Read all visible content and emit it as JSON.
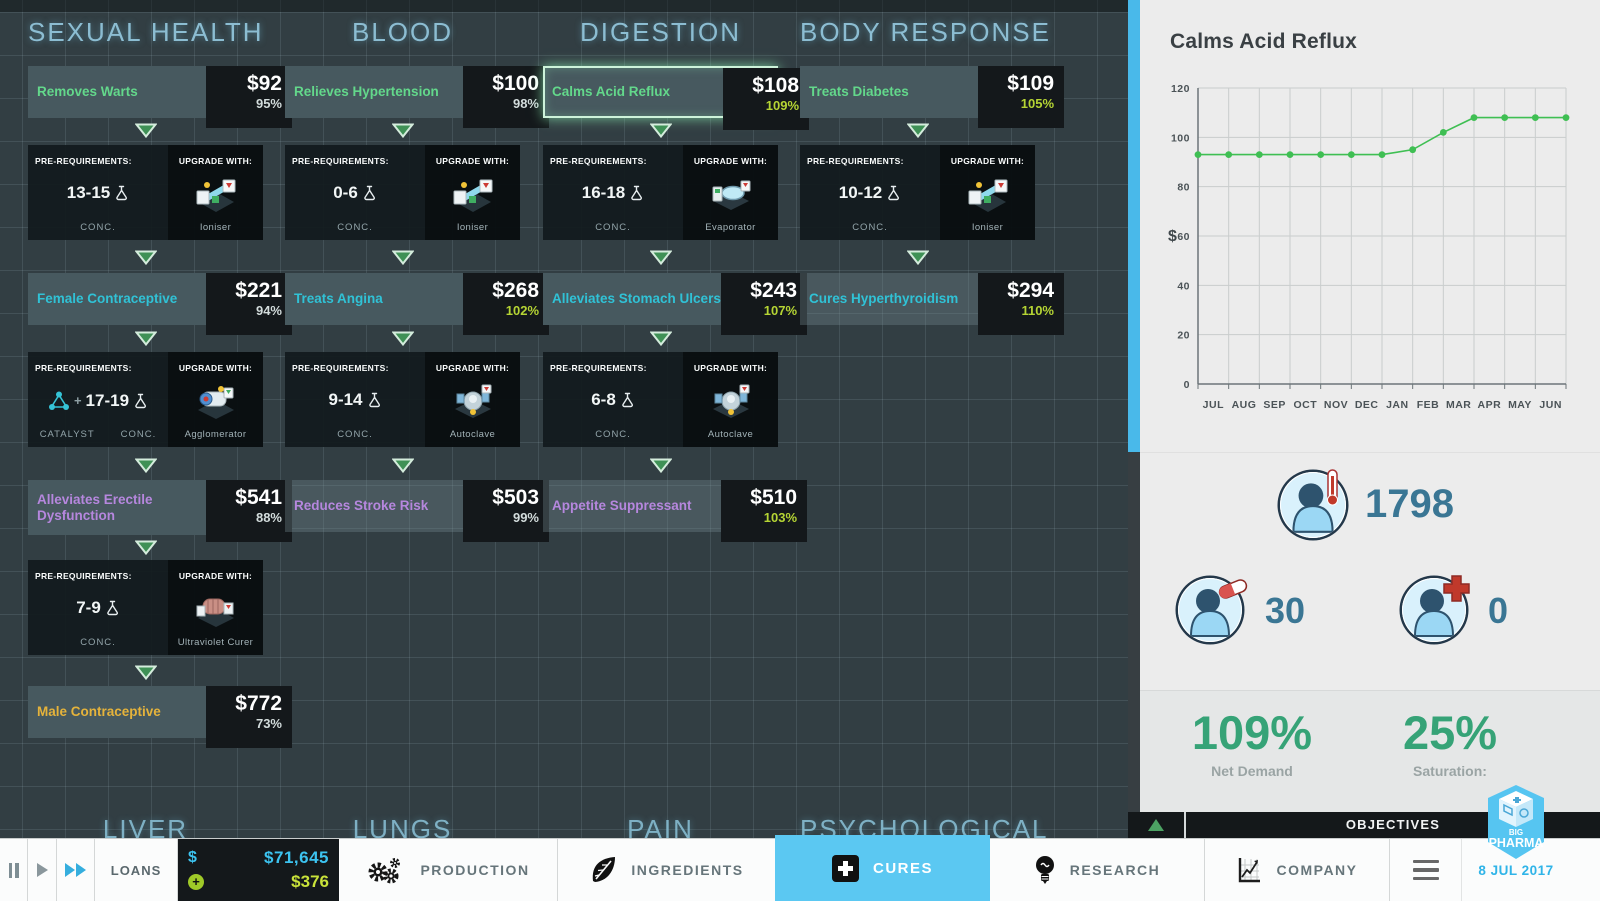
{
  "colors": {
    "accent_blue": "#5bc8f2",
    "tier_green": "#63d88b",
    "tier_cyan": "#30c2d6",
    "tier_purple": "#b687de",
    "tier_yellow": "#e5b33b",
    "pct_good_green": "#b5d434",
    "chart_line_green": "#3fbf53",
    "money_cyan": "#3cc3f0",
    "money_income_green": "#c9e23a",
    "stat_number_blue": "#3a7694",
    "panel_pct_green": "#36a377",
    "scrollbar_thumb": "#49b9ea"
  },
  "labels": {
    "prereq": "PRE-REQUIREMENTS:",
    "upgrade": "UPGRADE WITH:",
    "conc": "CONC.",
    "catalyst": "CATALYST"
  },
  "main": {
    "columns": [
      {
        "header": "SEXUAL HEALTH",
        "cures": [
          {
            "name": "Removes Warts",
            "price": "$92",
            "percent": "95%"
          },
          {
            "name": "Female Contraceptive",
            "price": "$221",
            "percent": "94%"
          },
          {
            "name": "Alleviates Erectile Dysfunction",
            "price": "$541",
            "percent": "88%"
          },
          {
            "name": "Male Contraceptive",
            "price": "$772",
            "percent": "73%"
          }
        ],
        "prereqs": [
          {
            "range": "13-15",
            "machine": "Ioniser"
          },
          {
            "range": "17-19",
            "machine": "Agglomerator",
            "catalyst": true
          },
          {
            "range": "7-9",
            "machine": "Ultraviolet Curer"
          }
        ]
      },
      {
        "header": "BLOOD",
        "cures": [
          {
            "name": "Relieves Hypertension",
            "price": "$100",
            "percent": "98%"
          },
          {
            "name": "Treats Angina",
            "price": "$268",
            "percent": "102%"
          },
          {
            "name": "Reduces Stroke Risk",
            "price": "$503",
            "percent": "99%"
          }
        ],
        "prereqs": [
          {
            "range": "0-6",
            "machine": "Ioniser"
          },
          {
            "range": "9-14",
            "machine": "Autoclave"
          }
        ]
      },
      {
        "header": "DIGESTION",
        "cures": [
          {
            "name": "Calms Acid Reflux",
            "price": "$108",
            "percent": "109%"
          },
          {
            "name": "Alleviates Stomach Ulcers",
            "price": "$243",
            "percent": "107%"
          },
          {
            "name": "Appetite Suppressant",
            "price": "$510",
            "percent": "103%"
          }
        ],
        "prereqs": [
          {
            "range": "16-18",
            "machine": "Evaporator"
          },
          {
            "range": "6-8",
            "machine": "Autoclave"
          }
        ]
      },
      {
        "header": "BODY RESPONSE",
        "cures": [
          {
            "name": "Treats Diabetes",
            "price": "$109",
            "percent": "105%"
          },
          {
            "name": "Cures Hyperthyroidism",
            "price": "$294",
            "percent": "110%"
          }
        ],
        "prereqs": [
          {
            "range": "10-12",
            "machine": "Ioniser"
          }
        ]
      }
    ],
    "bottom_headers": [
      "LIVER",
      "LUNGS",
      "PAIN",
      "PSYCHOLOGICAL"
    ]
  },
  "chart_data": {
    "type": "line",
    "title": "Calms Acid Reflux",
    "ylabel": "$",
    "x_labels": [
      "JUL",
      "AUG",
      "SEP",
      "OCT",
      "NOV",
      "DEC",
      "JAN",
      "FEB",
      "MAR",
      "APR",
      "MAY",
      "JUN"
    ],
    "yticks": [
      0,
      20,
      40,
      60,
      80,
      100,
      120
    ],
    "ylim": [
      0,
      120
    ],
    "values": [
      93,
      93,
      93,
      93,
      93,
      93,
      93,
      95,
      102,
      108,
      108,
      108,
      108
    ],
    "line_color": "#3fbf53",
    "grid": true,
    "legend": "none"
  },
  "panel": {
    "title": "Calms Acid Reflux",
    "patients_sick": "1798",
    "patients_treated": "30",
    "patients_cured": "0",
    "net_demand_value": "109%",
    "net_demand_label": "Net Demand",
    "saturation_value": "25%",
    "saturation_label": "Saturation:",
    "objectives_label": "OBJECTIVES"
  },
  "toolbar": {
    "loans": "LOANS",
    "balance": "$71,645",
    "income": "$376",
    "production": "PRODUCTION",
    "ingredients": "INGREDIENTS",
    "cures": "CURES",
    "research": "RESEARCH",
    "company": "COMPANY"
  },
  "logo": {
    "big": "BIG",
    "pharma": "PHARMA",
    "date": "8 JUL 2017"
  }
}
